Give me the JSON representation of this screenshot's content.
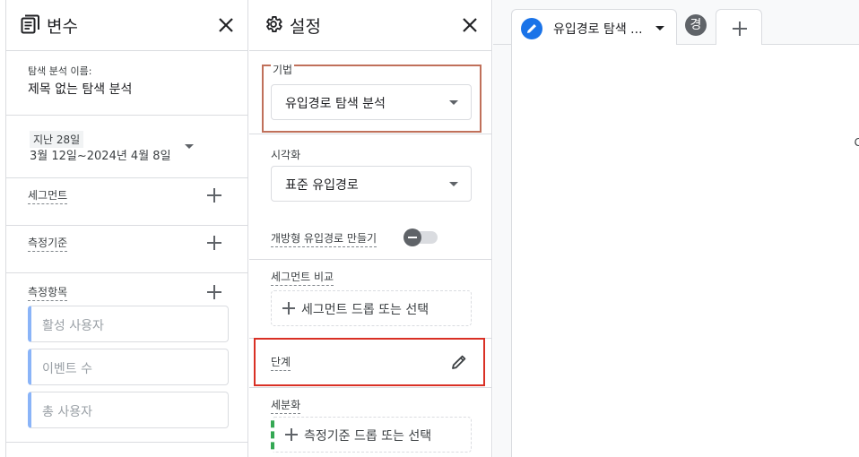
{
  "variables_panel": {
    "title": "변수",
    "exploration_name_label": "탐색 분석 이름:",
    "exploration_name": "제목 없는 탐색 분석",
    "date_range_preset": "지난 28일",
    "date_range": "3월 12일~2024년 4월 8일",
    "segments_label": "세그먼트",
    "dimensions_label": "측정기준",
    "metrics_label": "측정항목",
    "metrics": [
      "활성 사용자",
      "이벤트 수",
      "총 사용자"
    ]
  },
  "settings_panel": {
    "title": "설정",
    "technique_label": "기법",
    "technique_value": "유입경로 탐색 분석",
    "visualization_label": "시각화",
    "visualization_value": "표준 유입경로",
    "open_funnel_label": "개방형 유입경로 만들기",
    "open_funnel_enabled": false,
    "segment_comparison_label": "세그먼트 비교",
    "segment_drop_text": "세그먼트 드롭 또는 선택",
    "steps_label": "단계",
    "breakdown_label": "세분화",
    "breakdown_drop_text": "측정기준 드롭 또는 선택"
  },
  "main": {
    "active_tab_label": "유입경로 탐색 ...",
    "avatar_letter": "경",
    "canvas_clipped_text": "C"
  },
  "colors": {
    "highlight_technique": "#c0705a",
    "highlight_steps": "#d93025",
    "metric_accent": "#8ab4f8",
    "breakdown_accent": "#34a853",
    "tab_badge": "#1a73e8"
  }
}
